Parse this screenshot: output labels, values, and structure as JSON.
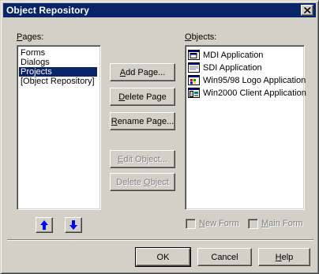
{
  "window": {
    "title": "Object Repository"
  },
  "pages": {
    "label_prefix": "",
    "label_accel": "P",
    "label_rest": "ages:",
    "items": [
      {
        "label": "Forms",
        "selected": false
      },
      {
        "label": "Dialogs",
        "selected": false
      },
      {
        "label": "Projects",
        "selected": true
      },
      {
        "label": "[Object Repository]",
        "selected": false
      }
    ]
  },
  "objects": {
    "label_accel": "O",
    "label_rest": "bjects:",
    "items": [
      {
        "label": "MDI Application",
        "icon": "mdi-application-icon"
      },
      {
        "label": "SDI Application",
        "icon": "sdi-application-icon"
      },
      {
        "label": "Win95/98 Logo Application",
        "icon": "win95-logo-application-icon"
      },
      {
        "label": "Win2000 Client Application",
        "icon": "win2000-client-application-icon"
      }
    ]
  },
  "buttons": {
    "add_page": {
      "accel": "A",
      "rest": "dd Page..."
    },
    "delete_page": {
      "accel": "D",
      "rest": "elete Page"
    },
    "rename_page": {
      "accel": "R",
      "rest": "ename Page..."
    },
    "edit_object": {
      "accel": "E",
      "rest": "dit Object..."
    },
    "delete_object": {
      "pre": "Delete ",
      "accel": "O",
      "rest": "bject"
    },
    "ok": "OK",
    "cancel": "Cancel",
    "help": {
      "accel": "H",
      "rest": "elp"
    }
  },
  "checkboxes": {
    "new_form": {
      "accel": "N",
      "rest": "ew Form",
      "checked": false
    },
    "main_form": {
      "accel": "M",
      "rest": "ain Form",
      "checked": false
    }
  },
  "icons": {
    "move_up": "arrow-up-icon",
    "move_down": "arrow-down-icon",
    "close": "close-icon"
  },
  "colors": {
    "titlebar": "#0a246a",
    "selection": "#0a246a",
    "face": "#d4d0c8",
    "arrow": "#0000ff"
  }
}
